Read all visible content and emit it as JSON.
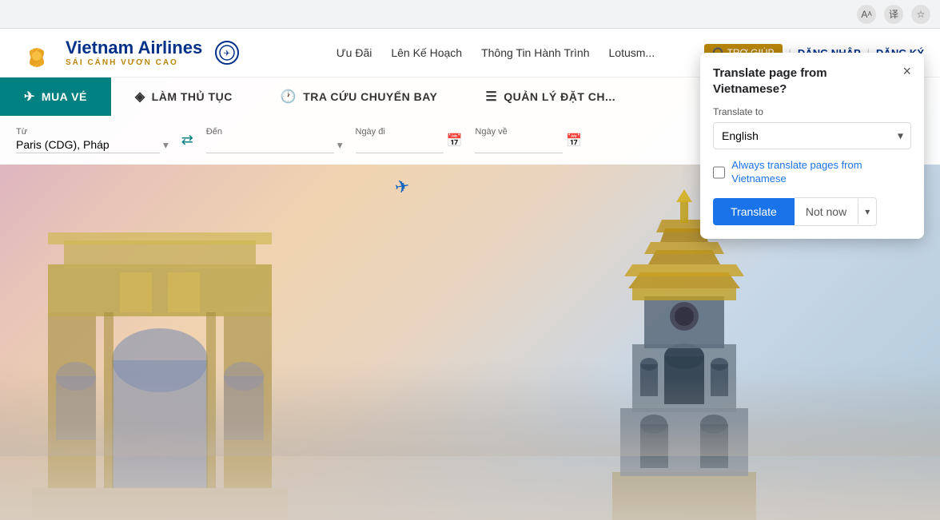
{
  "browser": {
    "icons": [
      "font-size-icon",
      "translate-browser-icon",
      "bookmark-icon"
    ]
  },
  "header": {
    "logo_name": "Vietnam Airlines",
    "logo_tagline": "SÁI CÁNH VƯƠN CAO",
    "nav_items": [
      "Ưu Đãi",
      "Lên Kế Hoạch",
      "Thông Tin Hành Trình",
      "Lotusm..."
    ],
    "help_btn": "TRỢ GIÚP",
    "login_btn": "ĐĂNG NHẬP",
    "register_btn": "ĐĂNG KÝ"
  },
  "nav_tabs": [
    {
      "label": "MUA VÉ",
      "icon": "✈",
      "active": true
    },
    {
      "label": "LÀM THỦ TỤC",
      "icon": "◈",
      "active": false
    },
    {
      "label": "TRA CỨU CHUYẾN BAY",
      "icon": "🕐",
      "active": false
    },
    {
      "label": "QUẢN LÝ ĐẶT CH...",
      "icon": "☰",
      "active": false
    }
  ],
  "search": {
    "from_label": "Từ",
    "from_value": "Paris (CDG), Pháp",
    "to_label": "Đến",
    "to_placeholder": "",
    "depart_label": "Ngày đi",
    "return_label": "Ngày về"
  },
  "translate_popup": {
    "title": "Translate page from Vietnamese?",
    "translate_to_label": "Translate to",
    "language": "English",
    "always_translate_text": "Always translate pages from",
    "always_translate_lang": "Vietnamese",
    "translate_btn": "Translate",
    "not_now_btn": "Not now",
    "close_label": "×"
  }
}
